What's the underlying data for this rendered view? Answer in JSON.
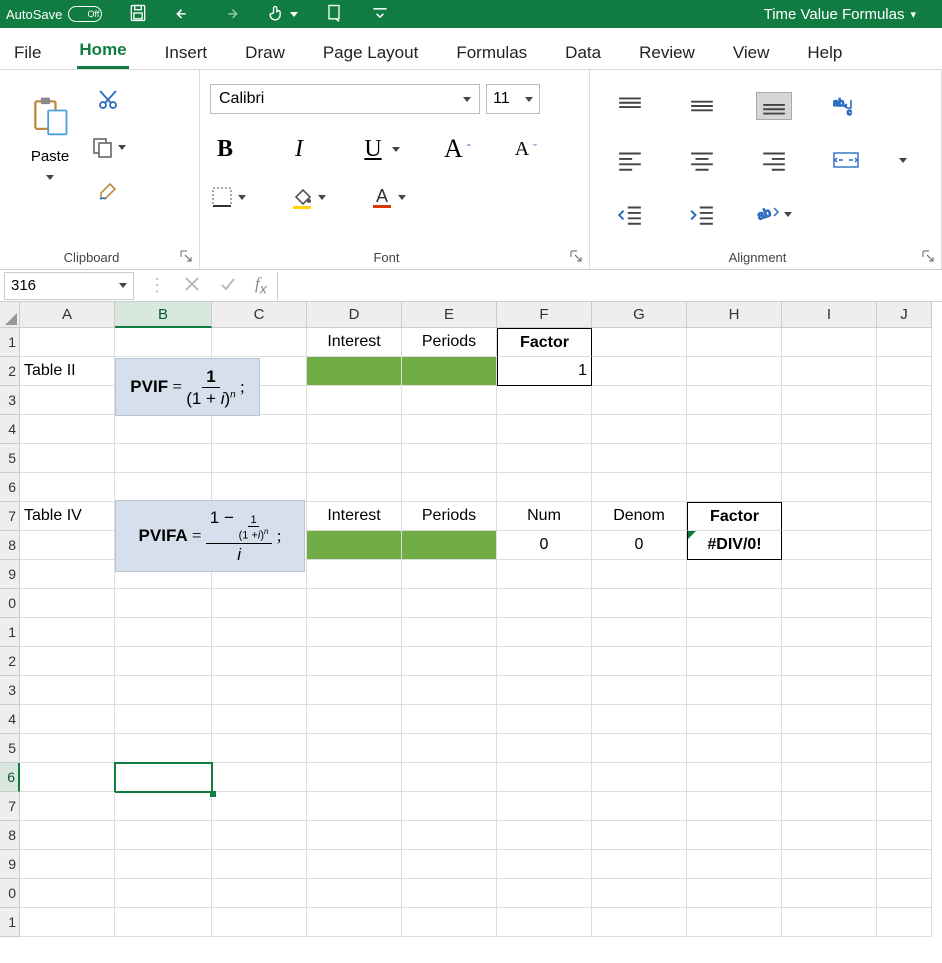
{
  "titlebar": {
    "autosave_label": "AutoSave",
    "autosave_state": "Off",
    "doc_name": "Time Value Formulas"
  },
  "tabs": {
    "file": "File",
    "home": "Home",
    "insert": "Insert",
    "draw": "Draw",
    "page_layout": "Page Layout",
    "formulas": "Formulas",
    "data": "Data",
    "review": "Review",
    "view": "View",
    "help": "Help"
  },
  "ribbon": {
    "clipboard": {
      "paste": "Paste",
      "label": "Clipboard"
    },
    "font": {
      "name": "Calibri",
      "size": "11",
      "bold": "B",
      "italic": "I",
      "underline": "U",
      "grow": "A",
      "shrink": "A",
      "label": "Font"
    },
    "align": {
      "label": "Alignment"
    }
  },
  "formula_bar": {
    "name_box": "316",
    "formula": ""
  },
  "columns": [
    "A",
    "B",
    "C",
    "D",
    "E",
    "F",
    "G",
    "H",
    "I",
    "J"
  ],
  "row_labels": [
    "1",
    "2",
    "3",
    "4",
    "5",
    "6",
    "7",
    "8",
    "9",
    "0",
    "1",
    "2",
    "3",
    "4",
    "5",
    "6",
    "7",
    "8",
    "9",
    "0",
    "1"
  ],
  "cells": {
    "A2": "Table II",
    "D1": "Interest",
    "E1": "Periods",
    "F1": "Factor",
    "F2": "1",
    "A7": "Table IV",
    "D7": "Interest",
    "E7": "Periods",
    "F7": "Num",
    "G7": "Denom",
    "H7": "Factor",
    "F8": "0",
    "G8": "0",
    "H8": "#DIV/0!"
  },
  "formula_images": {
    "pvif_label": "PVIF",
    "pvifa_label": "PVIFA"
  }
}
